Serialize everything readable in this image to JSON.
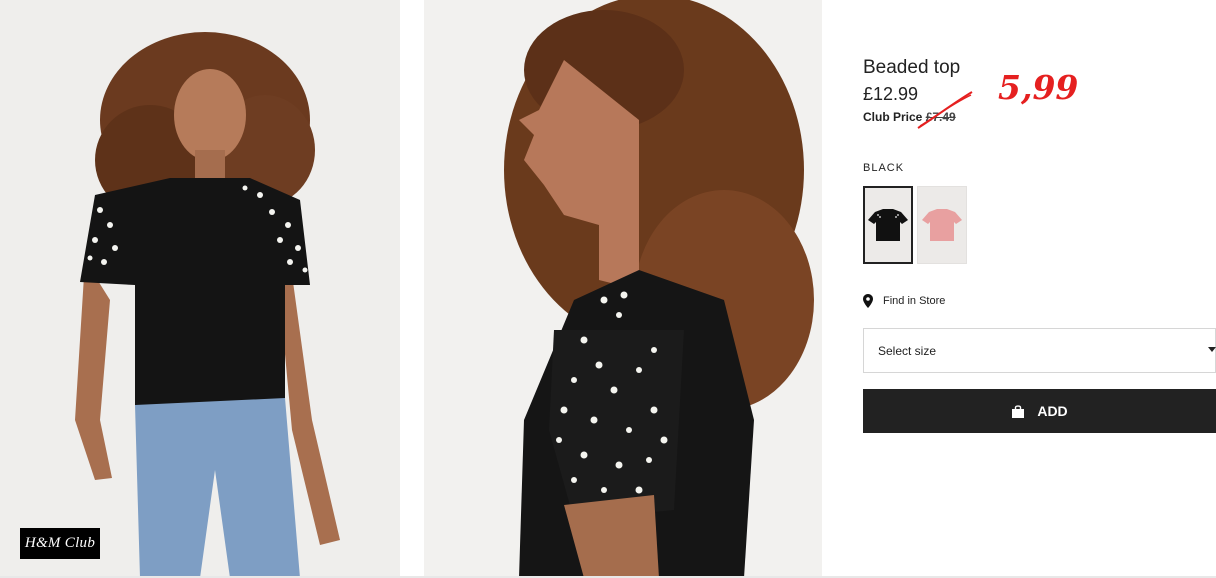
{
  "product": {
    "title": "Beaded top",
    "price": "£12.99",
    "club_price_label": "Club Price",
    "club_price_old": "£7.49",
    "handwritten_price": "5,99",
    "color_name": "BLACK"
  },
  "swatches": [
    {
      "name": "black",
      "color": "#111111"
    },
    {
      "name": "pink",
      "color": "#e8a0a0"
    }
  ],
  "find_in_store": "Find in Store",
  "size_select": {
    "value": "Select size"
  },
  "add_button": {
    "label": "ADD"
  },
  "club_badge": "H&M Club",
  "colors": {
    "accent": "#e52020",
    "button": "#222222"
  }
}
